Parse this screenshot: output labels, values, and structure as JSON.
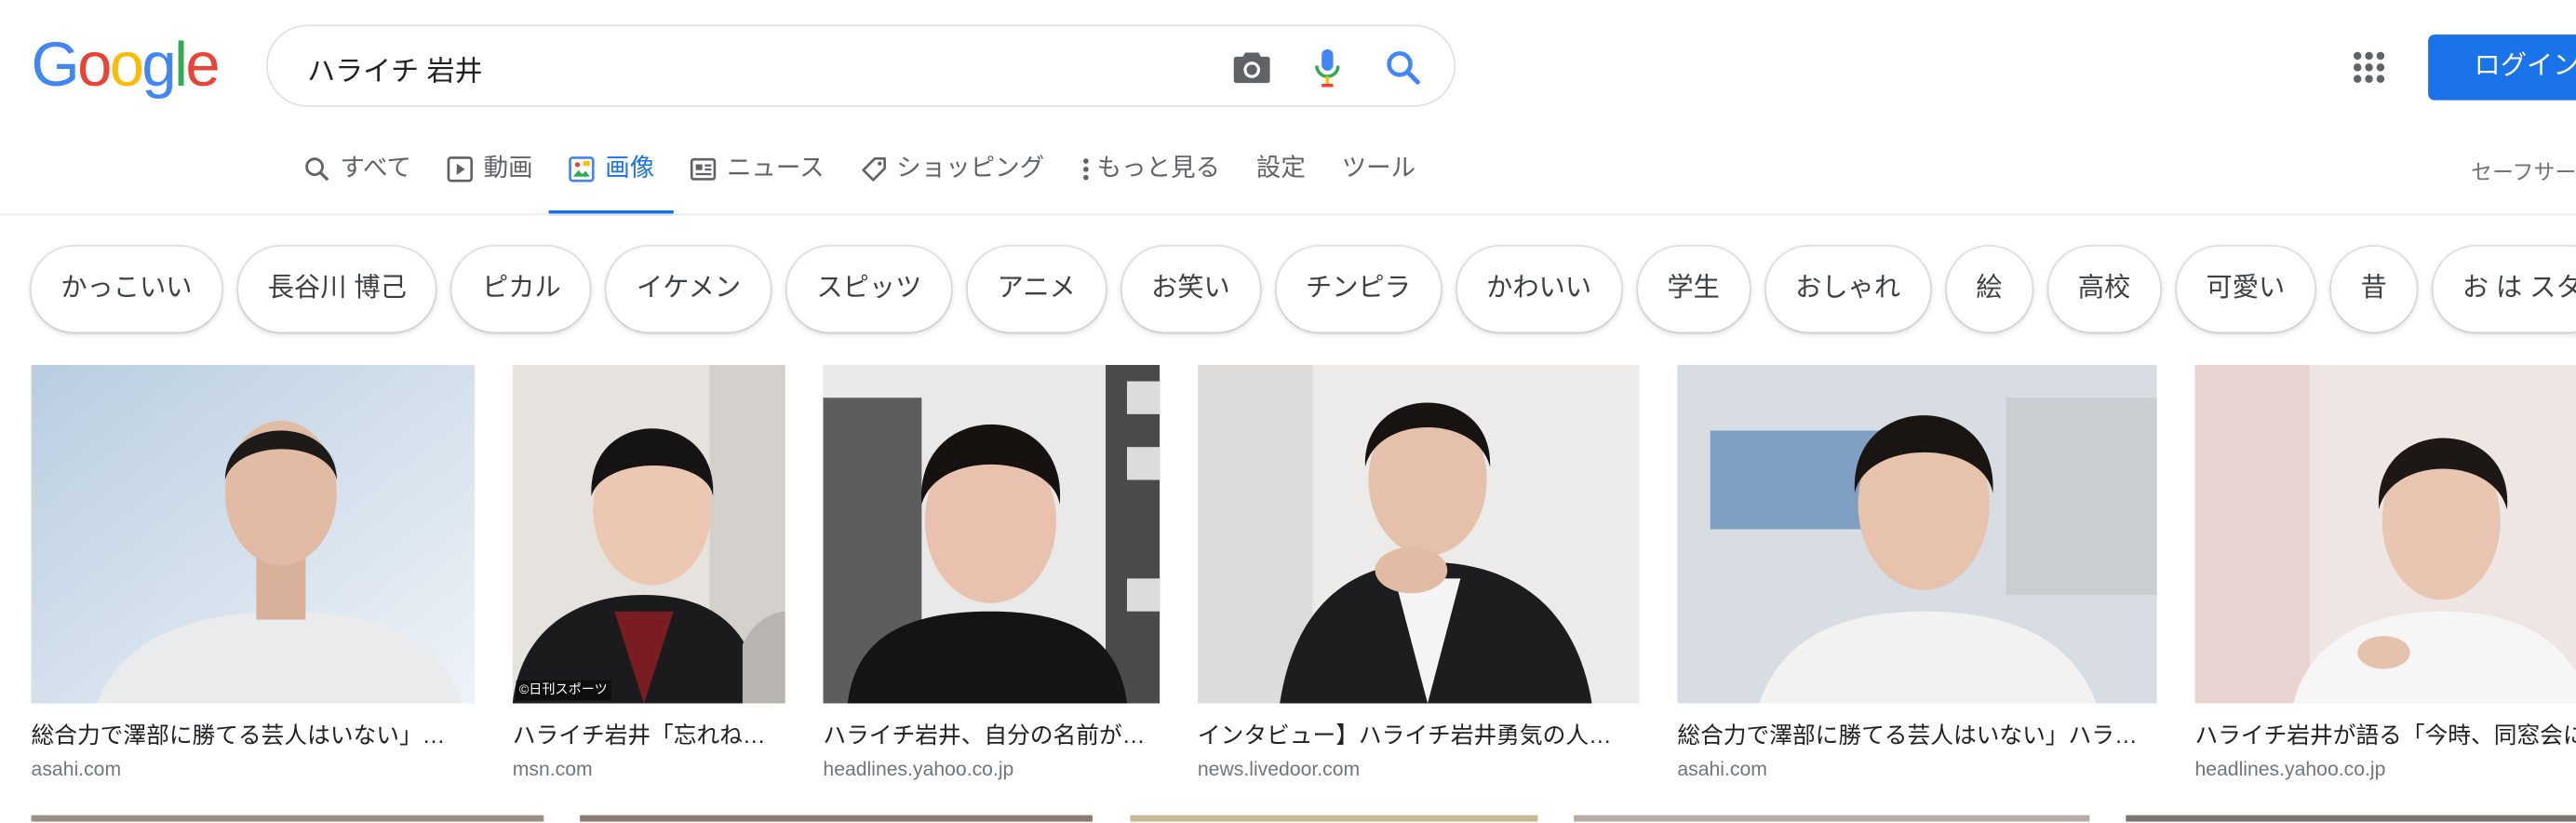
{
  "logo": {
    "letters": [
      "G",
      "o",
      "o",
      "g",
      "l",
      "e"
    ]
  },
  "search": {
    "value": "ハライチ 岩井"
  },
  "header": {
    "login_label": "ログイン"
  },
  "tabs": [
    {
      "label": "すべて",
      "icon": "search-icon",
      "active": false
    },
    {
      "label": "動画",
      "icon": "video-icon",
      "active": false
    },
    {
      "label": "画像",
      "icon": "image-icon",
      "active": true
    },
    {
      "label": "ニュース",
      "icon": "news-icon",
      "active": false
    },
    {
      "label": "ショッピング",
      "icon": "tag-icon",
      "active": false
    },
    {
      "label": "もっと見る",
      "icon": "more-vert-icon",
      "active": false
    },
    {
      "label": "設定",
      "icon": "",
      "active": false
    },
    {
      "label": "ツール",
      "icon": "",
      "active": false
    }
  ],
  "safesearch_label": "セーフサー",
  "chips": [
    "かっこいい",
    "長谷川 博己",
    "ピカル",
    "イケメン",
    "スピッツ",
    "アニメ",
    "お笑い",
    "チンピラ",
    "かわいい",
    "学生",
    "おしゃれ",
    "絵",
    "高校",
    "可愛い",
    "昔",
    "お は スタ"
  ],
  "results": [
    {
      "title": "総合力で澤部に勝てる芸人はいない」…",
      "source": "asahi.com"
    },
    {
      "title": "ハライチ岩井「忘れね…",
      "source": "msn.com"
    },
    {
      "title": "ハライチ岩井、自分の名前が…",
      "source": "headlines.yahoo.co.jp"
    },
    {
      "title": "インタビュー】ハライチ岩井勇気の人…",
      "source": "news.livedoor.com"
    },
    {
      "title": "総合力で澤部に勝てる芸人はいない」ハラ…",
      "source": "asahi.com"
    },
    {
      "title": "ハライチ岩井が語る「今時、同窓会に",
      "source": "headlines.yahoo.co.jp"
    }
  ],
  "photo_watermark": "©日刊スポーツ",
  "colors": {
    "accent": "#1a73e8",
    "text": "#202124",
    "muted": "#70757a"
  }
}
